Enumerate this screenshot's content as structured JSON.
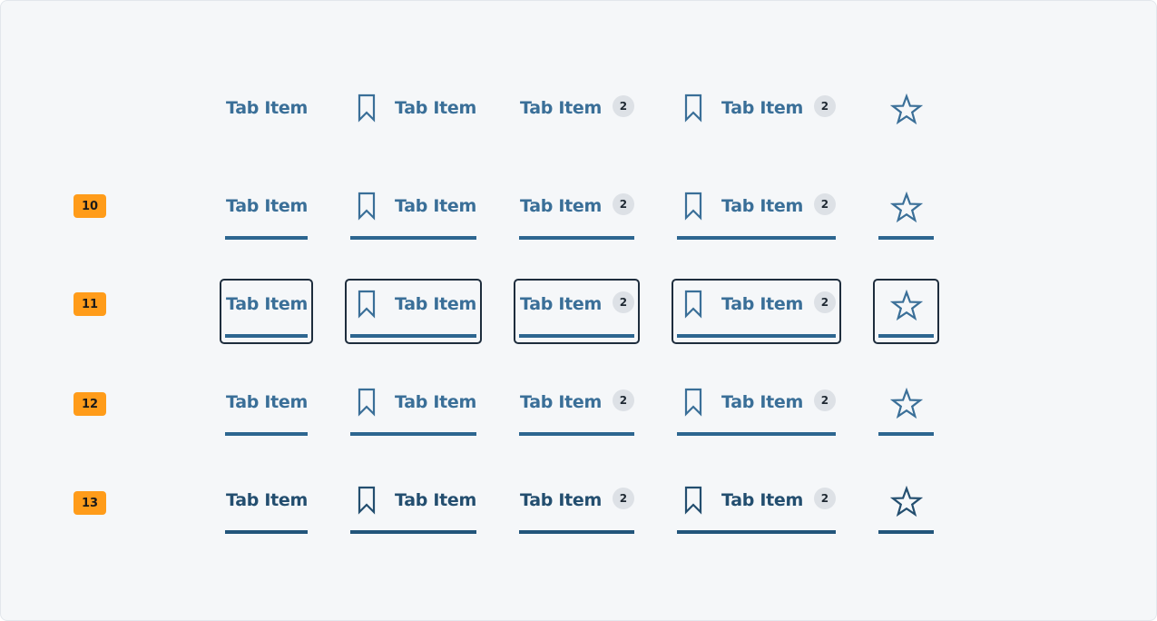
{
  "tab_label": "Tab Item",
  "counter_value": "2",
  "rows": [
    {
      "state_badge": ""
    },
    {
      "state_badge": "10"
    },
    {
      "state_badge": "11"
    },
    {
      "state_badge": "12"
    },
    {
      "state_badge": "13"
    }
  ],
  "colors": {
    "accent": "#2d6690",
    "label": "#3a6f98",
    "badge": "#ff9c1a",
    "focus_ring": "#1e2d3d",
    "counter_bg": "#dde1e6"
  },
  "icons": {
    "bookmark": "bookmark-icon",
    "star": "star-icon"
  }
}
